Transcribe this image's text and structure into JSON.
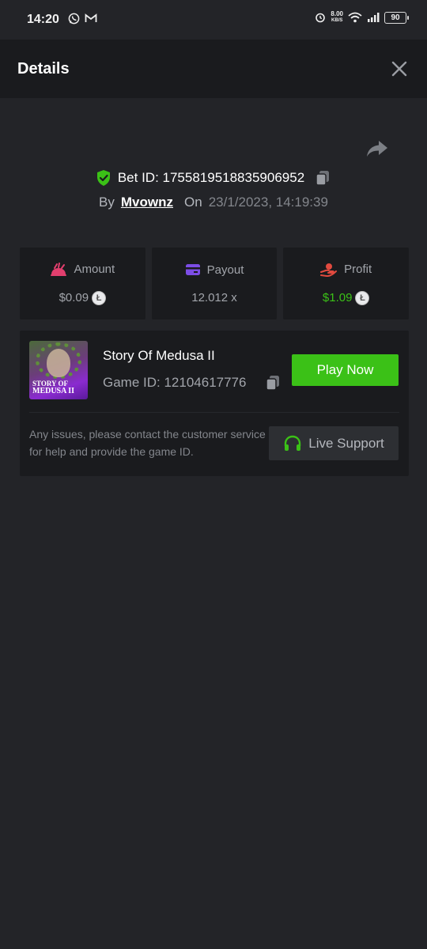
{
  "status_bar": {
    "time": "14:20",
    "net_speed_value": "8.00",
    "net_speed_unit": "KB/S",
    "battery": "90",
    "icons": [
      "whatsapp-icon",
      "gmail-icon",
      "alarm-icon",
      "wifi-icon",
      "signal-icon",
      "battery-icon"
    ]
  },
  "header": {
    "title": "Details",
    "close_icon": "close-icon"
  },
  "bet": {
    "bet_id_label": "Bet ID: 1755819518835906952",
    "by_label": "By",
    "username": "Mvownz",
    "on_label": "On",
    "date": "23/1/2023, 14:19:39"
  },
  "stats": [
    {
      "label": "Amount",
      "value": "$0.09",
      "icon": "amount-icon",
      "coin": "Ł"
    },
    {
      "label": "Payout",
      "value": "12.012 x",
      "icon": "card-icon"
    },
    {
      "label": "Profit",
      "value": "$1.09",
      "icon": "profit-icon",
      "coin": "Ł"
    }
  ],
  "game": {
    "name": "Story Of Medusa II",
    "game_id": "Game ID: 12104617776",
    "thumb_title_line1": "STORY OF",
    "thumb_title_line2": "MEDUSA II",
    "play_button": "Play Now",
    "support_text": "Any issues, please contact the customer service for help and provide the game ID.",
    "support_button": "Live Support"
  },
  "colors": {
    "background": "#232428",
    "panel": "#1a1b1e",
    "accent_green": "#3bc117",
    "muted_text": "#a2a5ab"
  }
}
